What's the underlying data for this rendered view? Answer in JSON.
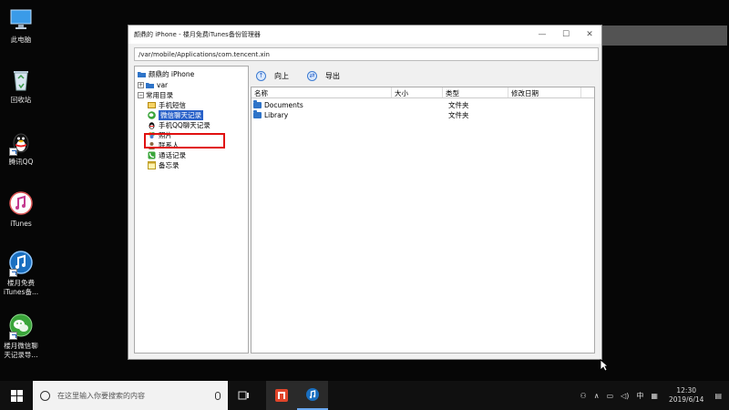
{
  "desktop": {
    "icons": [
      {
        "label": "此电脑"
      },
      {
        "label": "回收站"
      },
      {
        "label": "腾讯QQ"
      },
      {
        "label": "iTunes"
      },
      {
        "label": "楼月免费\niTunes备..."
      },
      {
        "label": "楼月微信聊\n天记录导..."
      }
    ]
  },
  "window": {
    "title": "颜鼎的 iPhone - 楼月免费iTunes备份管理器",
    "path": "/var/mobile/Applications/com.tencent.xin",
    "toolbar": {
      "up_label": "向上",
      "export_label": "导出"
    },
    "tree": {
      "root": "颜鼎的 iPhone",
      "var": "var",
      "common": "常用目录",
      "items": [
        "手机短信",
        "微信聊天记录",
        "手机QQ聊天记录",
        "照片",
        "联系人",
        "通话记录",
        "备忘录"
      ]
    },
    "list": {
      "columns": [
        "名称",
        "大小",
        "类型",
        "修改日期"
      ],
      "rows": [
        {
          "name": "Documents",
          "size": "",
          "type": "文件夹",
          "modified": ""
        },
        {
          "name": "Library",
          "size": "",
          "type": "文件夹",
          "modified": ""
        }
      ]
    }
  },
  "taskbar": {
    "search_placeholder": "在这里输入你要搜索的内容",
    "ime": "中",
    "time": "12:30",
    "date": "2019/6/14"
  },
  "colors": {
    "selection": "#2a62c9",
    "highlight": "#e01010",
    "folder": "#2f74c8"
  }
}
